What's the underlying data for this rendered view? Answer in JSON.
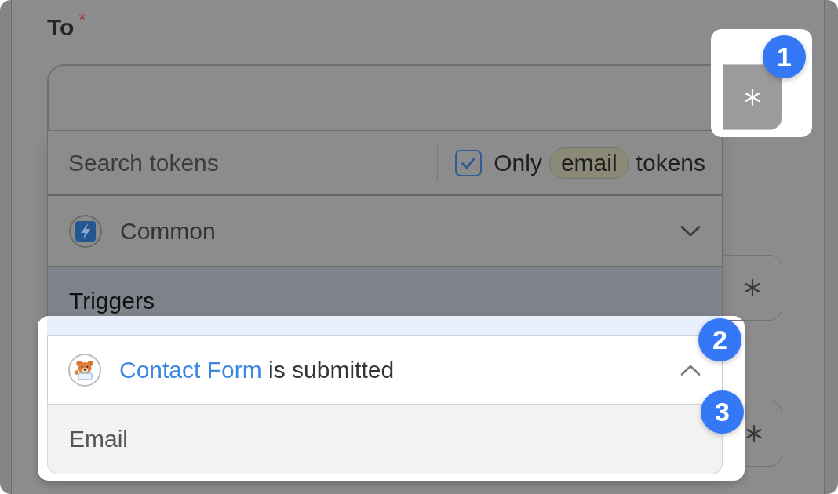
{
  "form": {
    "label": "To",
    "required_mark": "*",
    "token_buttons": [
      {
        "spotlighted": true,
        "step": "1"
      },
      {
        "spotlighted": false
      },
      {
        "spotlighted": false
      }
    ]
  },
  "token_picker": {
    "search": {
      "placeholder": "Search tokens"
    },
    "filter": {
      "checked": true,
      "label": "Only",
      "type_tag": "email",
      "suffix": "tokens"
    },
    "items": [
      {
        "kind": "group",
        "name": "Common",
        "expanded": false
      },
      {
        "kind": "section",
        "title": "Triggers"
      },
      {
        "kind": "trigger",
        "source": "Contact Form",
        "event": "is submitted",
        "expanded": true,
        "spotlighted": true,
        "step": "2",
        "tokens": [
          {
            "name": "Email",
            "step": "3"
          }
        ]
      }
    ]
  }
}
